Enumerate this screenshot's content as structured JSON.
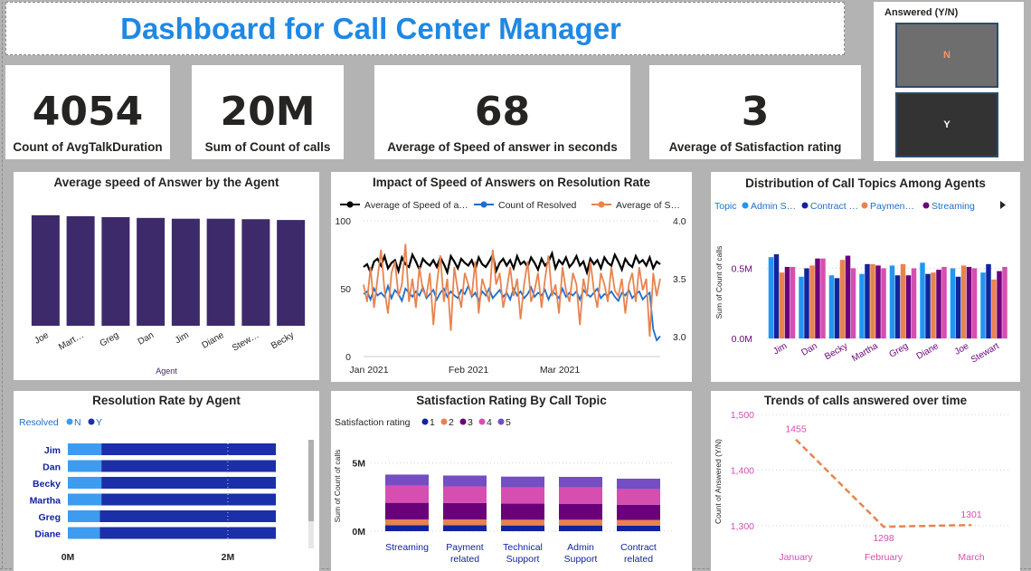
{
  "page": {
    "title": "Dashboard for Call Center Manager"
  },
  "slicer": {
    "header": "Answered (Y/N)",
    "options": [
      "N",
      "Y"
    ]
  },
  "kpis": [
    {
      "value": "4054",
      "label": "Count of AvgTalkDuration"
    },
    {
      "value": "20M",
      "label": "Sum of Count of calls"
    },
    {
      "value": "68",
      "label": "Average of Speed of answer in seconds"
    },
    {
      "value": "3",
      "label": "Average of Satisfaction rating"
    }
  ],
  "colors": {
    "accent": "#1e88e5",
    "navy": "#12239e",
    "purple": "#3d2a6b",
    "orange": "#e8834f",
    "pink": "#d64fb0"
  },
  "chart_data": [
    {
      "id": "speed-by-agent",
      "type": "bar",
      "title": "Average speed of Answer by the Agent",
      "xlabel": "Agent",
      "categories": [
        "Joe",
        "Mart…",
        "Greg",
        "Dan",
        "Jim",
        "Diane",
        "Stew…",
        "Becky"
      ],
      "values": [
        69.8,
        69.2,
        68.6,
        68.1,
        67.6,
        67.6,
        67.3,
        66.8
      ],
      "ylim": [
        0,
        80
      ],
      "color": "#3d2a6b"
    },
    {
      "id": "impact-speed-resolution",
      "type": "line",
      "title": "Impact of Speed of Answers on Resolution Rate",
      "legend": [
        "Average of Speed of a…",
        "Count of Resolved",
        "Average of S…"
      ],
      "left_ticks": [
        "0",
        "50",
        "100"
      ],
      "right_ticks": [
        "3.0",
        "3.5",
        "4.0"
      ],
      "x_ticks": [
        "Jan 2021",
        "Feb 2021",
        "Mar 2021"
      ],
      "series": [
        {
          "name": "Average of Speed of a…",
          "color": "#000000",
          "axis": "left",
          "values": [
            66,
            68,
            62,
            70,
            72,
            67,
            74,
            65,
            69,
            71,
            63,
            73,
            68,
            66,
            75,
            70,
            64,
            72,
            69,
            67,
            71,
            66,
            73,
            68,
            62,
            74,
            70,
            65,
            72,
            69,
            67,
            71,
            64,
            73,
            68,
            66,
            70,
            75,
            63,
            69,
            72,
            67,
            71,
            65,
            74,
            68,
            70,
            66,
            73,
            69,
            64,
            72,
            67,
            70,
            76,
            65,
            71,
            68,
            73,
            66,
            69,
            74,
            67,
            70,
            62,
            72,
            68,
            71,
            65,
            73,
            69,
            67,
            75,
            70,
            64,
            72,
            68,
            66,
            74,
            69,
            71,
            67,
            73,
            65,
            70,
            68
          ]
        },
        {
          "name": "Count of Resolved",
          "color": "#1e6fc9",
          "axis": "left",
          "values": [
            46,
            48,
            42,
            50,
            45,
            47,
            44,
            52,
            43,
            49,
            46,
            41,
            50,
            47,
            44,
            48,
            45,
            51,
            43,
            46,
            49,
            42,
            47,
            50,
            44,
            48,
            45,
            43,
            49,
            46,
            52,
            44,
            47,
            41,
            48,
            45,
            50,
            43,
            46,
            49,
            44,
            47,
            42,
            50,
            45,
            48,
            43,
            46,
            51,
            44,
            47,
            45,
            49,
            42,
            48,
            46,
            43,
            50,
            44,
            47,
            45,
            48,
            42,
            49,
            46,
            44,
            47,
            50,
            43,
            46,
            45,
            48,
            44,
            41,
            47,
            45,
            49,
            43,
            46,
            48,
            42,
            45,
            47,
            20,
            12,
            15
          ]
        },
        {
          "name": "Average of S…",
          "color": "#e8834f",
          "axis": "right",
          "values": [
            3.45,
            3.3,
            3.6,
            3.25,
            3.5,
            3.75,
            3.4,
            3.2,
            3.55,
            3.65,
            3.35,
            3.45,
            3.8,
            3.3,
            3.5,
            3.25,
            3.6,
            3.4,
            3.35,
            3.55,
            3.1,
            3.45,
            3.7,
            3.3,
            3.5,
            3.05,
            3.6,
            3.4,
            3.25,
            3.55,
            3.45,
            3.35,
            3.65,
            3.2,
            3.5,
            3.4,
            3.3,
            3.75,
            3.45,
            3.55,
            3.25,
            3.4,
            3.6,
            3.35,
            3.5,
            3.15,
            3.45,
            3.65,
            3.3,
            3.4,
            3.55,
            3.25,
            3.5,
            3.7,
            3.35,
            3.45,
            3.2,
            3.6,
            3.4,
            3.3,
            3.55,
            3.45,
            3.1,
            3.5,
            3.35,
            3.65,
            3.4,
            3.25,
            3.55,
            3.45,
            3.3,
            3.6,
            3.4,
            3.35,
            3.5,
            3.2,
            3.45,
            3.55,
            3.3,
            3.6,
            3.4,
            3.5,
            3.0,
            3.55,
            3.35,
            3.5
          ]
        }
      ]
    },
    {
      "id": "topics-among-agents",
      "type": "bar",
      "title": "Distribution of Call Topics Among Agents",
      "legend_title": "Topic",
      "ylabel": "Sum of Count of calls",
      "y_ticks": [
        "0.0M",
        "0.5M"
      ],
      "ylim": [
        0,
        0.8
      ],
      "categories": [
        "Jim",
        "Dan",
        "Becky",
        "Martha",
        "Greg",
        "Diane",
        "Joe",
        "Stewart"
      ],
      "series": [
        {
          "name": "Admin S…",
          "color": "#2196f3",
          "values": [
            0.58,
            0.44,
            0.45,
            0.46,
            0.52,
            0.54,
            0.5,
            0.47
          ]
        },
        {
          "name": "Contract …",
          "color": "#12239e",
          "values": [
            0.6,
            0.5,
            0.43,
            0.53,
            0.45,
            0.46,
            0.44,
            0.53
          ]
        },
        {
          "name": "Paymen…",
          "color": "#e8834f",
          "values": [
            0.47,
            0.52,
            0.56,
            0.53,
            0.53,
            0.47,
            0.52,
            0.42
          ]
        },
        {
          "name": "Streaming",
          "color": "#6b007b",
          "values": [
            0.51,
            0.57,
            0.59,
            0.52,
            0.45,
            0.49,
            0.51,
            0.48
          ]
        },
        {
          "name": "",
          "color": "#d64fb0",
          "values": [
            0.51,
            0.57,
            0.5,
            0.5,
            0.5,
            0.51,
            0.5,
            0.51
          ]
        }
      ]
    },
    {
      "id": "resolution-by-agent",
      "type": "bar",
      "title": "Resolution Rate by Agent",
      "legend_title": "Resolved",
      "categories": [
        "Jim",
        "Dan",
        "Becky",
        "Martha",
        "Greg",
        "Diane"
      ],
      "x_ticks": [
        "0M",
        "2M"
      ],
      "xlim": [
        0,
        2.6
      ],
      "series": [
        {
          "name": "N",
          "color": "#3d9bf0",
          "values": [
            0.42,
            0.42,
            0.42,
            0.42,
            0.4,
            0.4
          ]
        },
        {
          "name": "Y",
          "color": "#1a2fa8",
          "values": [
            2.68,
            2.62,
            2.57,
            2.55,
            2.51,
            2.5
          ]
        }
      ]
    },
    {
      "id": "satisfaction-by-topic",
      "type": "bar",
      "title": "Satisfaction Rating By Call Topic",
      "legend_title": "Satisfaction rating",
      "ylabel": "Sum of Count of calls",
      "y_ticks": [
        "0M",
        "5M"
      ],
      "ylim": [
        0,
        6.5
      ],
      "categories": [
        "Streaming",
        "Payment related",
        "Technical Support",
        "Admin Support",
        "Contract related"
      ],
      "series": [
        {
          "name": "1",
          "color": "#12239e",
          "values": [
            0.43,
            0.43,
            0.42,
            0.42,
            0.41
          ]
        },
        {
          "name": "2",
          "color": "#e8834f",
          "values": [
            0.43,
            0.43,
            0.42,
            0.42,
            0.41
          ]
        },
        {
          "name": "3",
          "color": "#6b007b",
          "values": [
            1.22,
            1.2,
            1.18,
            1.17,
            1.12
          ]
        },
        {
          "name": "4",
          "color": "#d64fb0",
          "values": [
            1.25,
            1.22,
            1.2,
            1.19,
            1.15
          ]
        },
        {
          "name": "5",
          "color": "#744ec2",
          "values": [
            0.82,
            0.8,
            0.78,
            0.78,
            0.76
          ]
        }
      ]
    },
    {
      "id": "trend-answered",
      "type": "line",
      "title": "Trends of calls answered over time",
      "ylabel": "Count of Answered (Y/N)",
      "categories": [
        "January",
        "February",
        "March"
      ],
      "values": [
        1455,
        1298,
        1301
      ],
      "data_labels": [
        "1455",
        "1298",
        "1301"
      ],
      "y_ticks": [
        "1,300",
        "1,400",
        "1,500"
      ],
      "ylim": [
        1272,
        1510
      ],
      "color": "#e8834f"
    }
  ]
}
